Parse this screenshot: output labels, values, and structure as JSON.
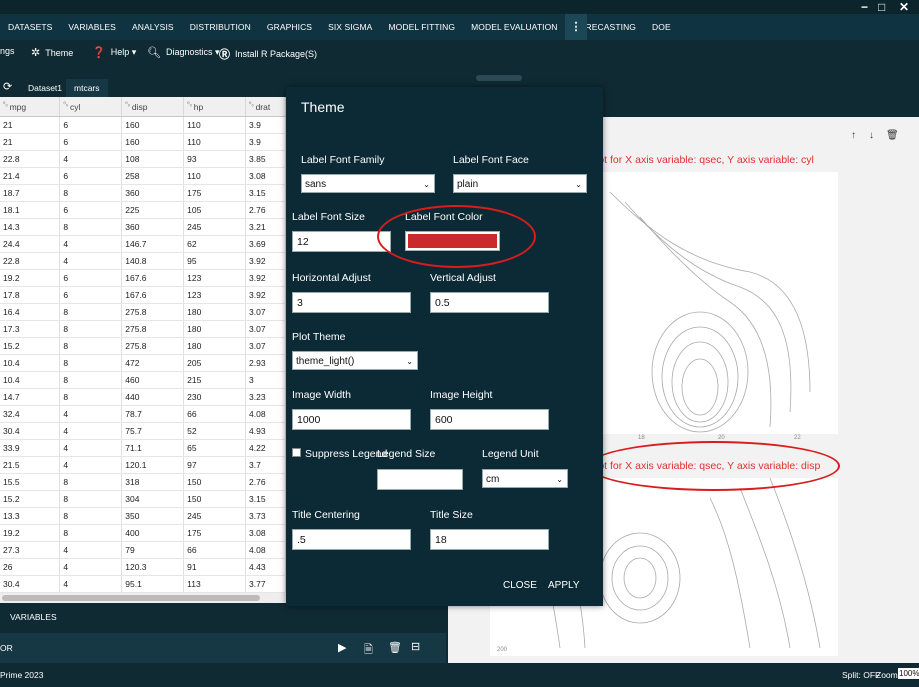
{
  "window": {
    "minimize": "−",
    "maximize": "□",
    "close": "✕"
  },
  "menu": [
    "DATASETS",
    "VARIABLES",
    "ANALYSIS",
    "DISTRIBUTION",
    "GRAPHICS",
    "SIX SIGMA",
    "MODEL FITTING",
    "MODEL EVALUATION",
    "FORECASTING",
    "DOE"
  ],
  "toolbar": {
    "settings": "ngs",
    "theme": "Theme",
    "help": "Help ▾",
    "diagnostics": "Diagnostics ▾",
    "install": "Install R Package(S)"
  },
  "tabs": {
    "dataset1": "Dataset1",
    "mtcars": "mtcars"
  },
  "grid": {
    "columns": [
      "mpg",
      "cyl",
      "disp",
      "hp",
      "drat"
    ],
    "rows": [
      [
        "21",
        "6",
        "160",
        "110",
        "3.9"
      ],
      [
        "21",
        "6",
        "160",
        "110",
        "3.9"
      ],
      [
        "22.8",
        "4",
        "108",
        "93",
        "3.85"
      ],
      [
        "21.4",
        "6",
        "258",
        "110",
        "3.08"
      ],
      [
        "18.7",
        "8",
        "360",
        "175",
        "3.15"
      ],
      [
        "18.1",
        "6",
        "225",
        "105",
        "2.76"
      ],
      [
        "14.3",
        "8",
        "360",
        "245",
        "3.21"
      ],
      [
        "24.4",
        "4",
        "146.7",
        "62",
        "3.69"
      ],
      [
        "22.8",
        "4",
        "140.8",
        "95",
        "3.92"
      ],
      [
        "19.2",
        "6",
        "167.6",
        "123",
        "3.92"
      ],
      [
        "17.8",
        "6",
        "167.6",
        "123",
        "3.92"
      ],
      [
        "16.4",
        "8",
        "275.8",
        "180",
        "3.07"
      ],
      [
        "17.3",
        "8",
        "275.8",
        "180",
        "3.07"
      ],
      [
        "15.2",
        "8",
        "275.8",
        "180",
        "3.07"
      ],
      [
        "10.4",
        "8",
        "472",
        "205",
        "2.93"
      ],
      [
        "10.4",
        "8",
        "460",
        "215",
        "3"
      ],
      [
        "14.7",
        "8",
        "440",
        "230",
        "3.23"
      ],
      [
        "32.4",
        "4",
        "78.7",
        "66",
        "4.08"
      ],
      [
        "30.4",
        "4",
        "75.7",
        "52",
        "4.93"
      ],
      [
        "33.9",
        "4",
        "71.1",
        "65",
        "4.22"
      ],
      [
        "21.5",
        "4",
        "120.1",
        "97",
        "3.7"
      ],
      [
        "15.5",
        "8",
        "318",
        "150",
        "2.76"
      ],
      [
        "15.2",
        "8",
        "304",
        "150",
        "3.15"
      ],
      [
        "13.3",
        "8",
        "350",
        "245",
        "3.73"
      ],
      [
        "19.2",
        "8",
        "400",
        "175",
        "3.08"
      ],
      [
        "27.3",
        "4",
        "79",
        "66",
        "4.08"
      ],
      [
        "26",
        "4",
        "120.3",
        "91",
        "4.43"
      ],
      [
        "30.4",
        "4",
        "95.1",
        "113",
        "3.77"
      ]
    ]
  },
  "left_bottom": {
    "variables": "VARIABLES",
    "strip_label": "OR"
  },
  "status": {
    "left": "Prime 2023",
    "split": "Split: OFF",
    "zoom_label": "Zoom:",
    "zoom": "100%"
  },
  "plots": {
    "title1": "lot  for X axis variable: qsec, Y axis variable: cyl",
    "title2": "lot  for X axis variable: qsec, Y axis variable: disp",
    "tick_18": "18",
    "tick_20": "20",
    "tick_22": "22",
    "tick_200": "200"
  },
  "dialog": {
    "title": "Theme",
    "label_font_family": "Label Font Family",
    "label_font_family_value": "sans",
    "label_font_face": "Label Font Face",
    "label_font_face_value": "plain",
    "label_font_size": "Label Font Size",
    "label_font_size_value": "12",
    "label_font_color": "Label Font Color",
    "label_font_color_hex": "#cc2a2a",
    "horizontal_adjust": "Horizontal Adjust",
    "horizontal_adjust_value": "3",
    "vertical_adjust": "Vertical Adjust",
    "vertical_adjust_value": "0.5",
    "plot_theme": "Plot Theme",
    "plot_theme_value": "theme_light()",
    "image_width": "Image Width",
    "image_width_value": "1000",
    "image_height": "Image Height",
    "image_height_value": "600",
    "suppress_legend": "Suppress Legend",
    "legend_size": "Legend Size",
    "legend_size_value": "",
    "legend_unit": "Legend Unit",
    "legend_unit_value": "cm",
    "title_centering": "Title Centering",
    "title_centering_value": ".5",
    "title_size": "Title Size",
    "title_size_value": "18",
    "close": "CLOSE",
    "apply": "APPLY"
  },
  "colors": {
    "accent_red": "#d91c1c",
    "dark_bg": "#0c2a35"
  }
}
